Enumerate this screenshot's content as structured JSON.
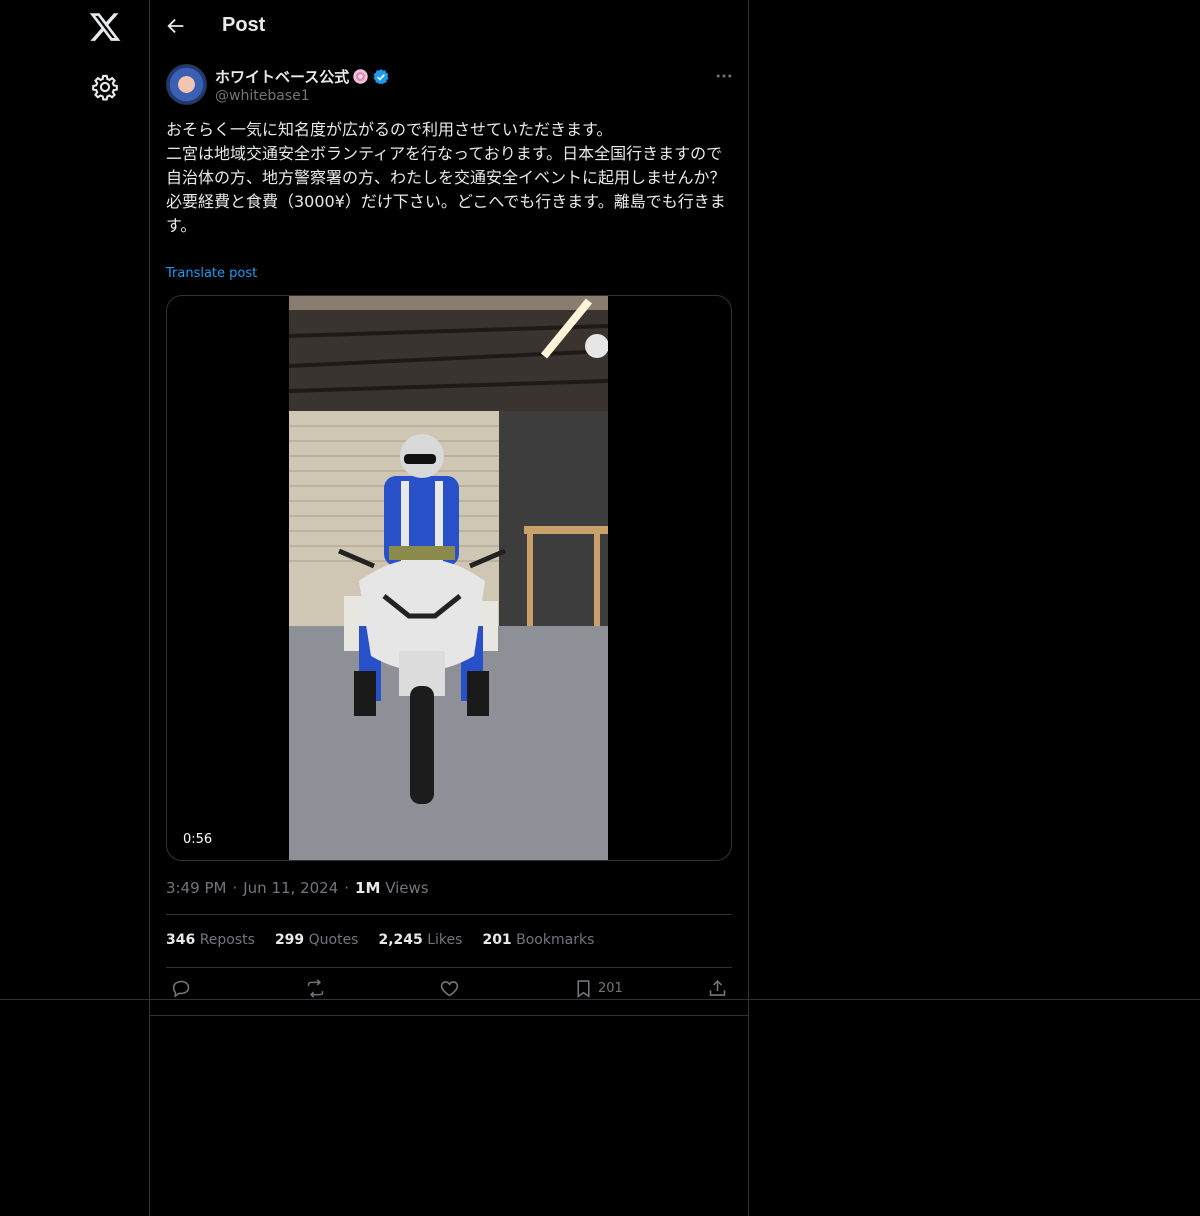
{
  "nav": {
    "logo_icon": "x-logo-icon",
    "settings_icon": "gear-icon"
  },
  "header": {
    "title": "Post",
    "back_icon": "arrow-left-icon"
  },
  "author": {
    "display_name": "ホワイトベース公式",
    "handle": "@whitebase1",
    "verified": true,
    "badge_icon": "flower-badge-icon"
  },
  "post": {
    "text": "おそらく一気に知名度が広がるので利用させていただきます。\n二宮は地域交通安全ボランティアを行なっております。日本全国行きますので自治体の方、地方警察署の方、わたしを交通安全イベントに起用しませんか？\n必要経費と食費（3000¥）だけ下さい。どこへでも行きます。離島でも行きます。",
    "translate_label": "Translate post",
    "video_duration": "0:56"
  },
  "meta": {
    "time": "3:49 PM",
    "sep1": "·",
    "date": "Jun 11, 2024",
    "sep2": "·",
    "views_num": "1M",
    "views_label": "Views"
  },
  "stats": {
    "reposts_num": "346",
    "reposts_label": "Reposts",
    "quotes_num": "299",
    "quotes_label": "Quotes",
    "likes_num": "2,245",
    "likes_label": "Likes",
    "bookmarks_num": "201",
    "bookmarks_label": "Bookmarks"
  },
  "actions": {
    "bookmark_count": "201"
  },
  "colors": {
    "background": "#000000",
    "text": "#e7e9ea",
    "muted": "#71767b",
    "accent": "#1d9bf0",
    "border": "#2f3336"
  }
}
